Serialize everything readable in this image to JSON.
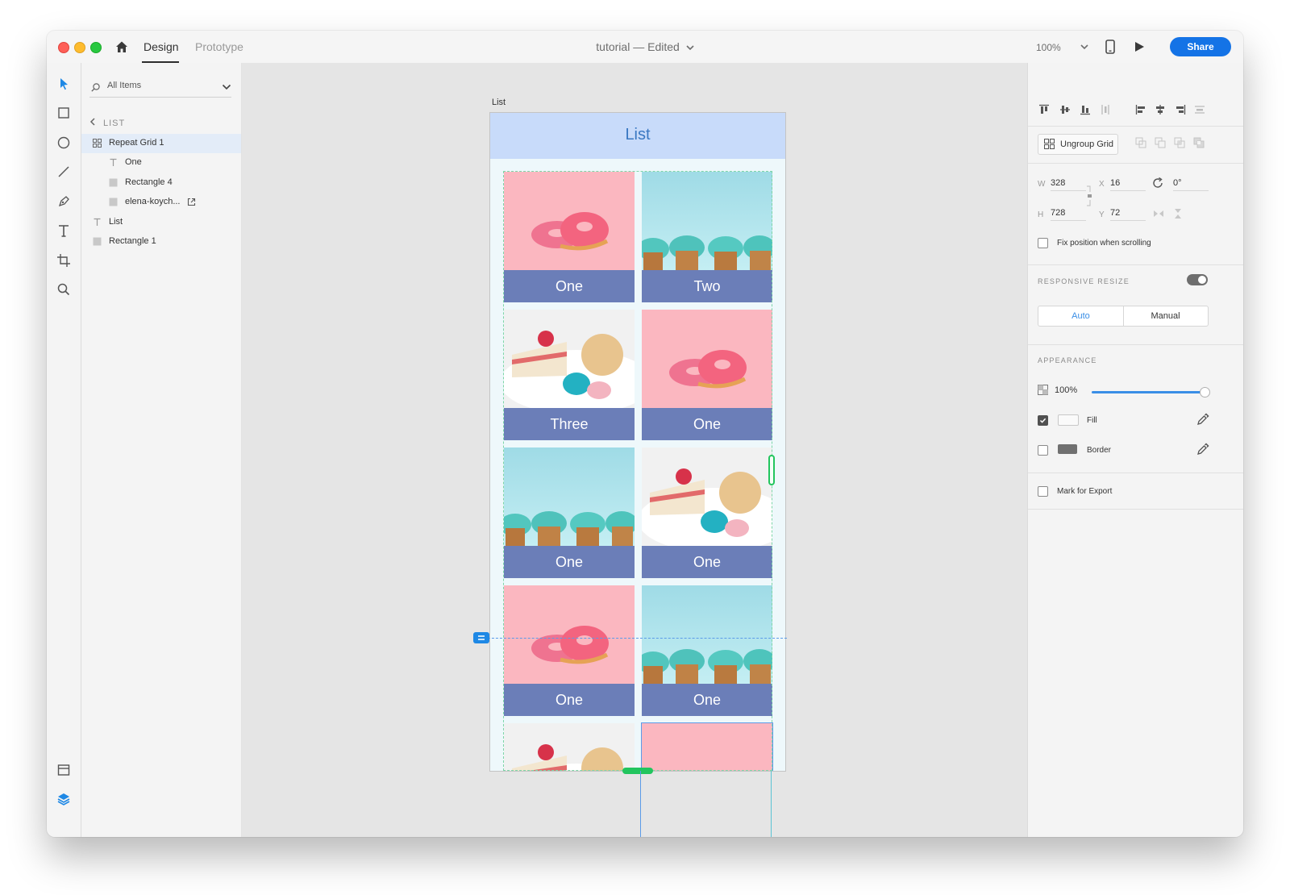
{
  "window": {
    "tabs": [
      {
        "label": "Design",
        "active": true
      },
      {
        "label": "Prototype",
        "active": false
      }
    ],
    "doc_title": "tutorial",
    "doc_separator": "—",
    "doc_status": "Edited",
    "zoom": "100%",
    "share_label": "Share",
    "accent_color": "#1473e6"
  },
  "toolbar": {
    "tools": [
      "select-icon",
      "rectangle-icon",
      "ellipse-icon",
      "line-icon",
      "pen-icon",
      "text-icon",
      "artboard-icon",
      "zoom-icon"
    ],
    "bottom_tools": [
      "assets-icon",
      "layers-icon"
    ]
  },
  "layers": {
    "search_placeholder": "All Items",
    "back_label": "LIST",
    "items": [
      {
        "label": "Repeat Grid 1",
        "icon": "grid-icon",
        "selected": true
      },
      {
        "label": "One",
        "icon": "text-layer-icon"
      },
      {
        "label": "Rectangle 4",
        "icon": "rectangle-layer-icon"
      },
      {
        "label": "elena-koych...",
        "icon": "image-layer-icon"
      },
      {
        "label": "List",
        "icon": "text-layer-icon"
      },
      {
        "label": "Rectangle 1",
        "icon": "rectangle-layer-icon"
      }
    ]
  },
  "canvas": {
    "artboard_label": "List",
    "artboard_title": "List",
    "cells": [
      {
        "caption": "One",
        "photo": "donuts"
      },
      {
        "caption": "Two",
        "photo": "cupcakes"
      },
      {
        "caption": "Three",
        "photo": "cake"
      },
      {
        "caption": "One",
        "photo": "donuts"
      },
      {
        "caption": "One",
        "photo": "cupcakes"
      },
      {
        "caption": "One",
        "photo": "cake"
      },
      {
        "caption": "One",
        "photo": "donuts"
      },
      {
        "caption": "One",
        "photo": "cupcakes"
      },
      {
        "caption": "",
        "photo": "cake"
      },
      {
        "caption": "",
        "photo": "donuts"
      }
    ]
  },
  "inspector": {
    "ungroup_label": "Ungroup Grid",
    "w_label": "W",
    "w": "328",
    "x_label": "X",
    "x": "16",
    "h_label": "H",
    "h": "728",
    "y_label": "Y",
    "y": "72",
    "rotation": "0°",
    "fix_position_label": "Fix position when scrolling",
    "responsive_title": "RESPONSIVE RESIZE",
    "responsive_on": true,
    "seg_auto": "Auto",
    "seg_manual": "Manual",
    "appearance_title": "APPEARANCE",
    "opacity": "100%",
    "opacity_value": 1.0,
    "fill_label": "Fill",
    "fill_checked": true,
    "border_label": "Border",
    "border_checked": false,
    "export_label": "Mark for Export"
  }
}
